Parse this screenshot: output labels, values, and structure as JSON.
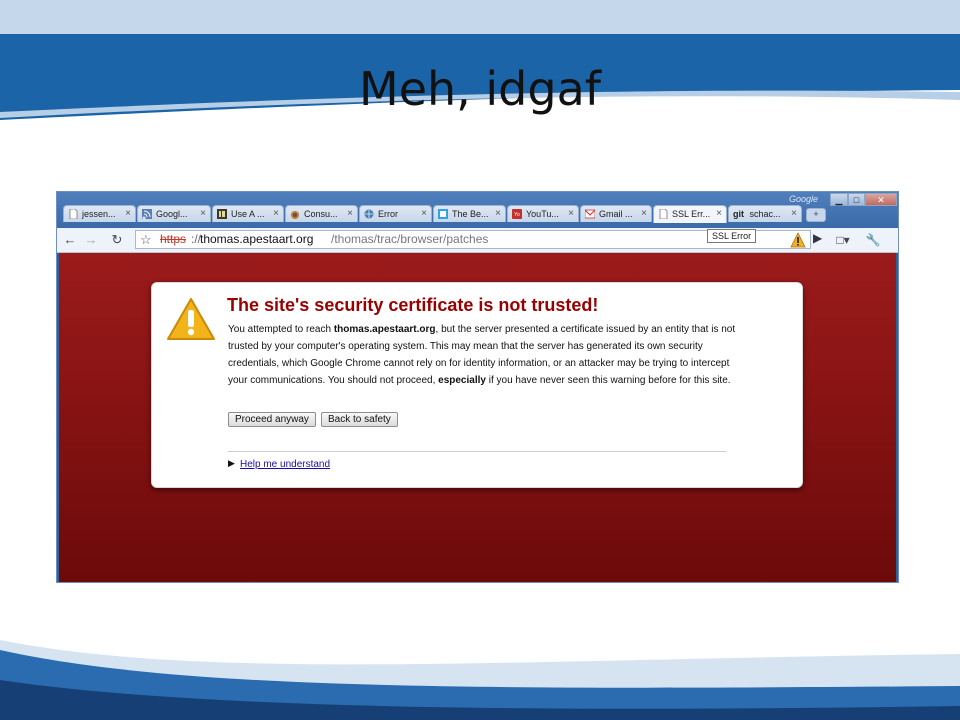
{
  "slide": {
    "title": "Meh, idgaf"
  },
  "window": {
    "google_label": "Google",
    "controls": {
      "minimize": "▁",
      "maximize": "□",
      "close": "✕"
    }
  },
  "tabs": [
    {
      "label": "jessen...",
      "icon": "page-icon"
    },
    {
      "label": "Googl...",
      "icon": "feed-icon"
    },
    {
      "label": "Use A ...",
      "icon": "site-icon"
    },
    {
      "label": "Consu...",
      "icon": "site-icon"
    },
    {
      "label": "Error",
      "icon": "site-icon"
    },
    {
      "label": "The Be...",
      "icon": "site-icon"
    },
    {
      "label": "YouTu...",
      "icon": "youtube-icon"
    },
    {
      "label": "Gmail ...",
      "icon": "gmail-icon"
    },
    {
      "label": "SSL Err...",
      "icon": "page-icon",
      "active": true
    },
    {
      "label": "schac...",
      "icon": "git-icon",
      "prefix": "git"
    }
  ],
  "toolbar": {
    "url_scheme": "https",
    "url_sep": "://",
    "url_host": "thomas.apestaart.org",
    "url_path": "/thomas/trac/browser/patches",
    "tooltip": "SSL Error"
  },
  "error_page": {
    "heading": "The site's security certificate is not trusted!",
    "body_1": "You attempted to reach ",
    "body_host": "thomas.apestaart.org",
    "body_2": ", but the server presented a certificate issued by an entity that is not trusted by your computer's operating system. This may mean that the server has generated its own security credentials, which Google Chrome cannot rely on for identity information, or an attacker may be trying to intercept your communications. You should not proceed, ",
    "body_especially": "especially",
    "body_3": " if you have never seen this warning before for this site.",
    "proceed_label": "Proceed anyway",
    "back_label": "Back to safety",
    "help_link": "Help me understand"
  },
  "colors": {
    "page_red": "#8a1414",
    "heading_red": "#990000",
    "frame_blue": "#3a6aa8"
  }
}
